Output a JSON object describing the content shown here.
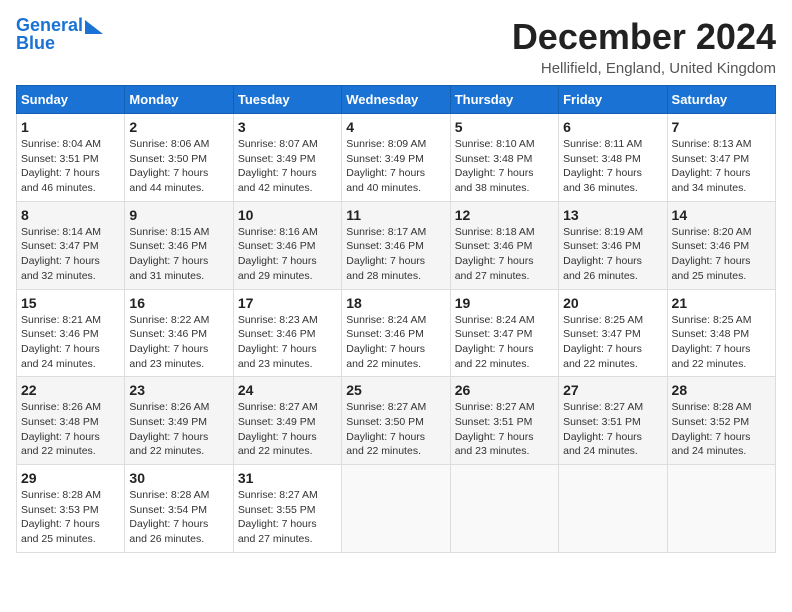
{
  "header": {
    "logo_line1": "General",
    "logo_line2": "Blue",
    "title": "December 2024",
    "subtitle": "Hellifield, England, United Kingdom"
  },
  "columns": [
    "Sunday",
    "Monday",
    "Tuesday",
    "Wednesday",
    "Thursday",
    "Friday",
    "Saturday"
  ],
  "weeks": [
    [
      {
        "day": "1",
        "info": "Sunrise: 8:04 AM\nSunset: 3:51 PM\nDaylight: 7 hours\nand 46 minutes."
      },
      {
        "day": "2",
        "info": "Sunrise: 8:06 AM\nSunset: 3:50 PM\nDaylight: 7 hours\nand 44 minutes."
      },
      {
        "day": "3",
        "info": "Sunrise: 8:07 AM\nSunset: 3:49 PM\nDaylight: 7 hours\nand 42 minutes."
      },
      {
        "day": "4",
        "info": "Sunrise: 8:09 AM\nSunset: 3:49 PM\nDaylight: 7 hours\nand 40 minutes."
      },
      {
        "day": "5",
        "info": "Sunrise: 8:10 AM\nSunset: 3:48 PM\nDaylight: 7 hours\nand 38 minutes."
      },
      {
        "day": "6",
        "info": "Sunrise: 8:11 AM\nSunset: 3:48 PM\nDaylight: 7 hours\nand 36 minutes."
      },
      {
        "day": "7",
        "info": "Sunrise: 8:13 AM\nSunset: 3:47 PM\nDaylight: 7 hours\nand 34 minutes."
      }
    ],
    [
      {
        "day": "8",
        "info": "Sunrise: 8:14 AM\nSunset: 3:47 PM\nDaylight: 7 hours\nand 32 minutes."
      },
      {
        "day": "9",
        "info": "Sunrise: 8:15 AM\nSunset: 3:46 PM\nDaylight: 7 hours\nand 31 minutes."
      },
      {
        "day": "10",
        "info": "Sunrise: 8:16 AM\nSunset: 3:46 PM\nDaylight: 7 hours\nand 29 minutes."
      },
      {
        "day": "11",
        "info": "Sunrise: 8:17 AM\nSunset: 3:46 PM\nDaylight: 7 hours\nand 28 minutes."
      },
      {
        "day": "12",
        "info": "Sunrise: 8:18 AM\nSunset: 3:46 PM\nDaylight: 7 hours\nand 27 minutes."
      },
      {
        "day": "13",
        "info": "Sunrise: 8:19 AM\nSunset: 3:46 PM\nDaylight: 7 hours\nand 26 minutes."
      },
      {
        "day": "14",
        "info": "Sunrise: 8:20 AM\nSunset: 3:46 PM\nDaylight: 7 hours\nand 25 minutes."
      }
    ],
    [
      {
        "day": "15",
        "info": "Sunrise: 8:21 AM\nSunset: 3:46 PM\nDaylight: 7 hours\nand 24 minutes."
      },
      {
        "day": "16",
        "info": "Sunrise: 8:22 AM\nSunset: 3:46 PM\nDaylight: 7 hours\nand 23 minutes."
      },
      {
        "day": "17",
        "info": "Sunrise: 8:23 AM\nSunset: 3:46 PM\nDaylight: 7 hours\nand 23 minutes."
      },
      {
        "day": "18",
        "info": "Sunrise: 8:24 AM\nSunset: 3:46 PM\nDaylight: 7 hours\nand 22 minutes."
      },
      {
        "day": "19",
        "info": "Sunrise: 8:24 AM\nSunset: 3:47 PM\nDaylight: 7 hours\nand 22 minutes."
      },
      {
        "day": "20",
        "info": "Sunrise: 8:25 AM\nSunset: 3:47 PM\nDaylight: 7 hours\nand 22 minutes."
      },
      {
        "day": "21",
        "info": "Sunrise: 8:25 AM\nSunset: 3:48 PM\nDaylight: 7 hours\nand 22 minutes."
      }
    ],
    [
      {
        "day": "22",
        "info": "Sunrise: 8:26 AM\nSunset: 3:48 PM\nDaylight: 7 hours\nand 22 minutes."
      },
      {
        "day": "23",
        "info": "Sunrise: 8:26 AM\nSunset: 3:49 PM\nDaylight: 7 hours\nand 22 minutes."
      },
      {
        "day": "24",
        "info": "Sunrise: 8:27 AM\nSunset: 3:49 PM\nDaylight: 7 hours\nand 22 minutes."
      },
      {
        "day": "25",
        "info": "Sunrise: 8:27 AM\nSunset: 3:50 PM\nDaylight: 7 hours\nand 22 minutes."
      },
      {
        "day": "26",
        "info": "Sunrise: 8:27 AM\nSunset: 3:51 PM\nDaylight: 7 hours\nand 23 minutes."
      },
      {
        "day": "27",
        "info": "Sunrise: 8:27 AM\nSunset: 3:51 PM\nDaylight: 7 hours\nand 24 minutes."
      },
      {
        "day": "28",
        "info": "Sunrise: 8:28 AM\nSunset: 3:52 PM\nDaylight: 7 hours\nand 24 minutes."
      }
    ],
    [
      {
        "day": "29",
        "info": "Sunrise: 8:28 AM\nSunset: 3:53 PM\nDaylight: 7 hours\nand 25 minutes."
      },
      {
        "day": "30",
        "info": "Sunrise: 8:28 AM\nSunset: 3:54 PM\nDaylight: 7 hours\nand 26 minutes."
      },
      {
        "day": "31",
        "info": "Sunrise: 8:27 AM\nSunset: 3:55 PM\nDaylight: 7 hours\nand 27 minutes."
      },
      {
        "day": "",
        "info": ""
      },
      {
        "day": "",
        "info": ""
      },
      {
        "day": "",
        "info": ""
      },
      {
        "day": "",
        "info": ""
      }
    ]
  ]
}
